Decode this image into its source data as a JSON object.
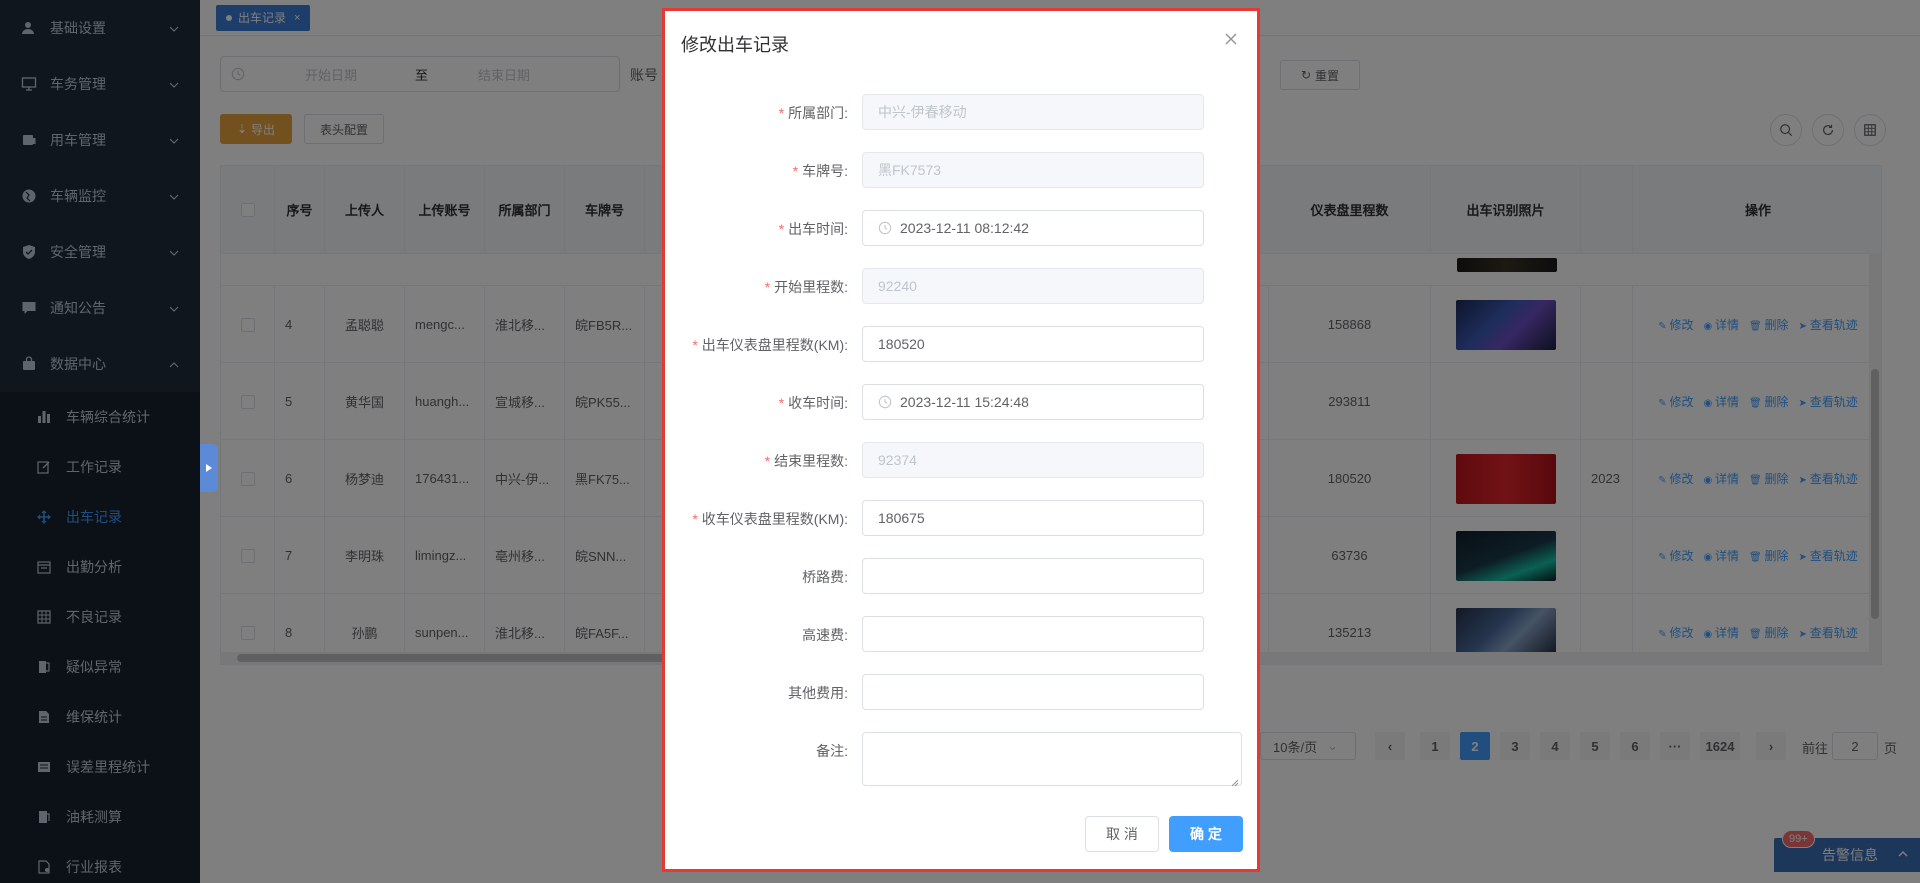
{
  "sidebar": {
    "menu": [
      {
        "label": "基础设置",
        "icon": "user-icon"
      },
      {
        "label": "车务管理",
        "icon": "monitor-icon"
      },
      {
        "label": "用车管理",
        "icon": "car-icon"
      },
      {
        "label": "车辆监控",
        "icon": "globe-icon"
      },
      {
        "label": "安全管理",
        "icon": "shield-icon"
      },
      {
        "label": "通知公告",
        "icon": "chat-icon"
      },
      {
        "label": "数据中心",
        "icon": "bag-icon"
      }
    ],
    "submenu": [
      {
        "label": "车辆综合统计",
        "icon": "bar-chart-icon"
      },
      {
        "label": "工作记录",
        "icon": "edit-icon"
      },
      {
        "label": "出车记录",
        "icon": "move-icon"
      },
      {
        "label": "出勤分析",
        "icon": "calendar-icon"
      },
      {
        "label": "不良记录",
        "icon": "grid-icon"
      },
      {
        "label": "疑似异常",
        "icon": "flag-icon"
      },
      {
        "label": "维保统计",
        "icon": "document-icon"
      },
      {
        "label": "误差里程统计",
        "icon": "table-icon"
      },
      {
        "label": "油耗测算",
        "icon": "gauge-icon"
      },
      {
        "label": "行业报表",
        "icon": "report-icon"
      }
    ],
    "active_sub": "出车记录"
  },
  "tabs": [
    {
      "label": "出车记录"
    }
  ],
  "search": {
    "start_placeholder": "开始日期",
    "range_separator": "至",
    "end_placeholder": "结束日期",
    "account_label": "账号",
    "reset_label": "重置"
  },
  "toolbar": {
    "export_label": "导出",
    "columns_label": "表头配置"
  },
  "table": {
    "headers": [
      "序号",
      "上传人",
      "上传账号",
      "所属部门",
      "车牌号",
      "仪表盘里程数",
      "出车识别照片",
      "操作"
    ],
    "rows": [
      {
        "no": "4",
        "uploader": "孟聪聪",
        "account": "mengc...",
        "dept": "淮北移...",
        "plate": "皖FB5R...",
        "odometer": "158868",
        "extra": ""
      },
      {
        "no": "5",
        "uploader": "黄华国",
        "account": "huangh...",
        "dept": "宣城移...",
        "plate": "皖PK55...",
        "odometer": "293811",
        "extra": ""
      },
      {
        "no": "6",
        "uploader": "杨梦迪",
        "account": "176431...",
        "dept": "中兴-伊...",
        "plate": "黑FK75...",
        "odometer": "180520",
        "extra": "2023"
      },
      {
        "no": "7",
        "uploader": "李明珠",
        "account": "limingz...",
        "dept": "亳州移...",
        "plate": "皖SNN...",
        "odometer": "63736",
        "extra": ""
      },
      {
        "no": "8",
        "uploader": "孙鹏",
        "account": "sunpen...",
        "dept": "淮北移...",
        "plate": "皖FA5F...",
        "odometer": "135213",
        "extra": ""
      }
    ],
    "ops": {
      "edit": "修改",
      "detail": "详情",
      "delete": "删除",
      "track": "查看轨迹"
    }
  },
  "pagination": {
    "page_size": "10条/页",
    "pages": [
      "1",
      "2",
      "3",
      "4",
      "5",
      "6",
      "···",
      "1624"
    ],
    "active": "2",
    "goto_prefix": "前往",
    "goto_value": "2",
    "goto_suffix": "页"
  },
  "alert": {
    "badge": "99+",
    "label": "告警信息"
  },
  "dialog": {
    "title": "修改出车记录",
    "fields": [
      {
        "label": "所属部门:",
        "required": true,
        "value": "中兴-伊春移动",
        "disabled": true,
        "type": "text"
      },
      {
        "label": "车牌号:",
        "required": true,
        "value": "黑FK7573",
        "disabled": true,
        "type": "text"
      },
      {
        "label": "出车时间:",
        "required": true,
        "value": "2023-12-11 08:12:42",
        "disabled": false,
        "type": "datetime"
      },
      {
        "label": "开始里程数:",
        "required": true,
        "value": "92240",
        "disabled": true,
        "type": "text"
      },
      {
        "label": "出车仪表盘里程数(KM):",
        "required": true,
        "value": "180520",
        "disabled": false,
        "type": "text"
      },
      {
        "label": "收车时间:",
        "required": true,
        "value": "2023-12-11 15:24:48",
        "disabled": false,
        "type": "datetime"
      },
      {
        "label": "结束里程数:",
        "required": true,
        "value": "92374",
        "disabled": true,
        "type": "text"
      },
      {
        "label": "收车仪表盘里程数(KM):",
        "required": true,
        "value": "180675",
        "disabled": false,
        "type": "text"
      },
      {
        "label": "桥路费:",
        "required": false,
        "value": "",
        "disabled": false,
        "type": "text"
      },
      {
        "label": "高速费:",
        "required": false,
        "value": "",
        "disabled": false,
        "type": "text"
      },
      {
        "label": "其他费用:",
        "required": false,
        "value": "",
        "disabled": false,
        "type": "text"
      },
      {
        "label": "备注:",
        "required": false,
        "value": "",
        "disabled": false,
        "type": "textarea"
      }
    ],
    "required_mark": "*",
    "cancel_label": "取 消",
    "confirm_label": "确 定"
  },
  "colors": {
    "sidebar_bg": "#1f2d3d",
    "primary": "#409eff",
    "warning": "#e6a23c",
    "danger_border": "#e53935"
  }
}
